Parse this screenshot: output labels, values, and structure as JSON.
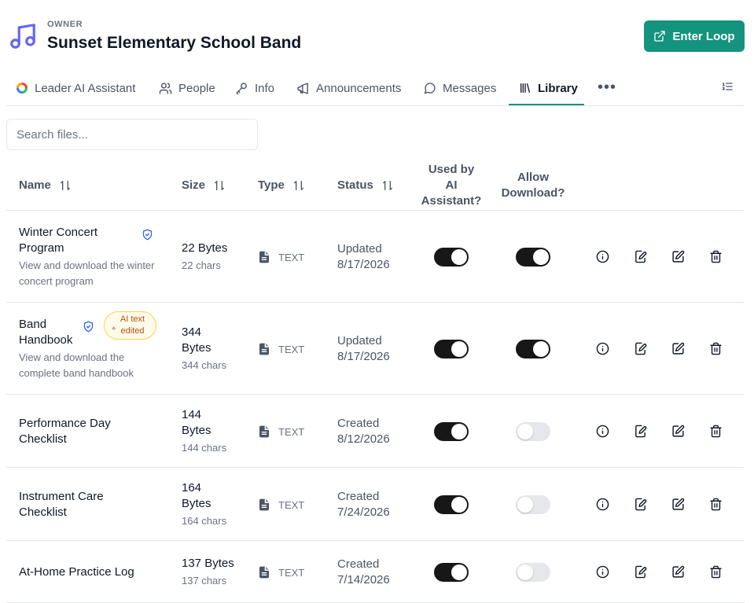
{
  "header": {
    "owner_label": "OWNER",
    "title": "Sunset Elementary School Band",
    "enter_button": "Enter Loop",
    "logo_icon": "music-note-icon",
    "brand_color": "#14937e"
  },
  "tabs": [
    {
      "label": "Leader AI Assistant",
      "icon": "ai-ring-icon"
    },
    {
      "label": "People",
      "icon": "people-icon"
    },
    {
      "label": "Info",
      "icon": "key-icon"
    },
    {
      "label": "Announcements",
      "icon": "megaphone-icon"
    },
    {
      "label": "Messages",
      "icon": "chat-bubble-icon"
    },
    {
      "label": "Library",
      "icon": "library-icon",
      "active": true
    }
  ],
  "search": {
    "placeholder": "Search files..."
  },
  "columns": {
    "name": "Name",
    "size": "Size",
    "type": "Type",
    "status": "Status",
    "used_by_ai": [
      "Used by",
      "AI",
      "Assistant?"
    ],
    "allow_download": [
      "Allow",
      "Download?"
    ]
  },
  "files": [
    {
      "name_lines": [
        "Winter Concert",
        "Program"
      ],
      "verified": true,
      "ai_badge": null,
      "description_lines": [
        "View and download the winter",
        "concert program"
      ],
      "size_lines": [
        "22 Bytes"
      ],
      "chars": "22 chars",
      "type": "TEXT",
      "status_lines": [
        "Updated",
        "8/17/2026"
      ],
      "used_by_ai": true,
      "allow_download": true
    },
    {
      "name_lines": [
        "Band",
        "Handbook"
      ],
      "verified": true,
      "ai_badge": [
        "AI text",
        "edited"
      ],
      "description_lines": [
        "View and download the",
        "complete band handbook"
      ],
      "size_lines": [
        "344",
        "Bytes"
      ],
      "chars": "344 chars",
      "type": "TEXT",
      "status_lines": [
        "Updated",
        "8/17/2026"
      ],
      "used_by_ai": true,
      "allow_download": true
    },
    {
      "name_lines": [
        "Performance Day",
        "Checklist"
      ],
      "verified": false,
      "ai_badge": null,
      "description_lines": [],
      "size_lines": [
        "144",
        "Bytes"
      ],
      "chars": "144 chars",
      "type": "TEXT",
      "status_lines": [
        "Created",
        "8/12/2026"
      ],
      "used_by_ai": true,
      "allow_download": false
    },
    {
      "name_lines": [
        "Instrument Care",
        "Checklist"
      ],
      "verified": false,
      "ai_badge": null,
      "description_lines": [],
      "size_lines": [
        "164",
        "Bytes"
      ],
      "chars": "164 chars",
      "type": "TEXT",
      "status_lines": [
        "Created",
        "7/24/2026"
      ],
      "used_by_ai": true,
      "allow_download": false
    },
    {
      "name_lines": [
        "At-Home Practice Log"
      ],
      "verified": false,
      "ai_badge": null,
      "description_lines": [],
      "size_lines": [
        "137 Bytes"
      ],
      "chars": "137 chars",
      "type": "TEXT",
      "status_lines": [
        "Created",
        "7/14/2026"
      ],
      "used_by_ai": true,
      "allow_download": false
    }
  ],
  "row_actions": [
    "info-icon",
    "edit-text-icon",
    "edit-icon",
    "trash-icon"
  ]
}
